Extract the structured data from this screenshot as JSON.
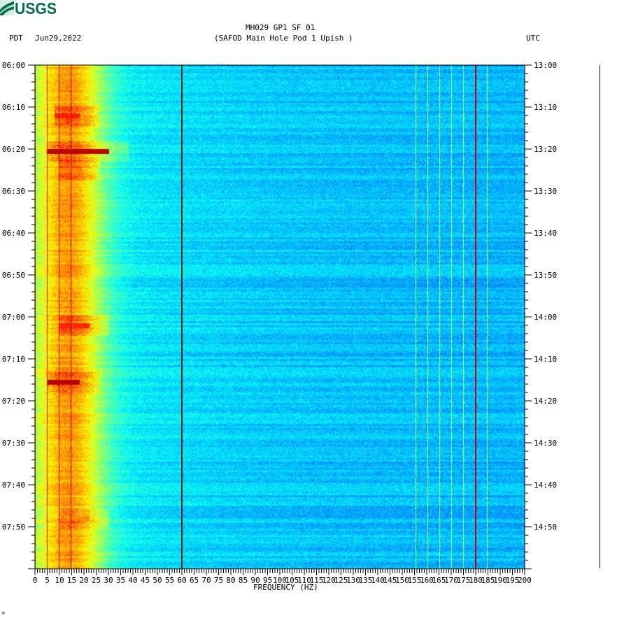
{
  "logo": {
    "text": "USGS",
    "color": "#00704a"
  },
  "header": {
    "title": "MH029 GP1 SF 01",
    "subtitle": "(SAFOD Main Hole Pod 1 Upish )",
    "left_tz": "PDT",
    "date": "Jun29,2022",
    "right_tz": "UTC"
  },
  "footer_mark": "*",
  "chart_data": {
    "type": "heatmap",
    "title": "MH029 GP1 SF 01",
    "xlabel": "FREQUENCY (HZ)",
    "xlim": [
      0,
      200
    ],
    "x_ticks": [
      "0",
      "5",
      "10",
      "15",
      "20",
      "25",
      "30",
      "35",
      "40",
      "45",
      "50",
      "55",
      "60",
      "65",
      "70",
      "75",
      "80",
      "85",
      "90",
      "95",
      "100",
      "105",
      "110",
      "115",
      "120",
      "125",
      "130",
      "135",
      "140",
      "145",
      "150",
      "155",
      "160",
      "165",
      "170",
      "175",
      "180",
      "185",
      "190",
      "195",
      "200"
    ],
    "y_range_minutes": [
      0,
      120
    ],
    "y_ticks_left": [
      "06:00",
      "06:10",
      "06:20",
      "06:30",
      "06:40",
      "06:50",
      "07:00",
      "07:10",
      "07:20",
      "07:30",
      "07:40",
      "07:50"
    ],
    "y_ticks_right": [
      "13:00",
      "13:10",
      "13:20",
      "13:30",
      "13:40",
      "13:50",
      "14:00",
      "14:10",
      "14:20",
      "14:30",
      "14:40",
      "14:50"
    ],
    "colormap": "jet",
    "persistent_lines_hz": [
      {
        "freq": 60,
        "level": "high"
      },
      {
        "freq": 180,
        "level": "very high"
      }
    ],
    "events": [
      {
        "time_min": 12,
        "fmin": 8,
        "fmax": 18,
        "level": "high"
      },
      {
        "time_min": 20.5,
        "fmin": 5,
        "fmax": 30,
        "level": "very high"
      },
      {
        "time_min": 25,
        "fmin": 10,
        "fmax": 18,
        "level": "medium"
      },
      {
        "time_min": 62,
        "fmin": 10,
        "fmax": 22,
        "level": "high"
      },
      {
        "time_min": 75.5,
        "fmin": 5,
        "fmax": 18,
        "level": "very high"
      },
      {
        "time_min": 108,
        "fmin": 10,
        "fmax": 22,
        "level": "medium"
      }
    ]
  }
}
